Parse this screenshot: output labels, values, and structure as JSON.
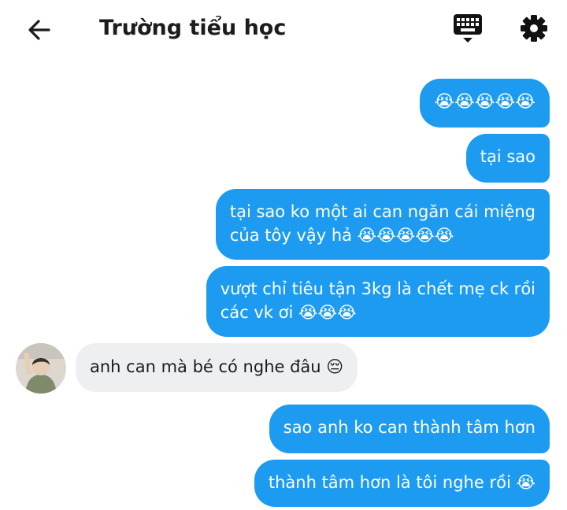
{
  "header": {
    "back_icon": "arrow-left-icon",
    "title": "Trường tiểu học",
    "keyboard_icon": "keyboard-icon",
    "settings_icon": "gear-icon"
  },
  "messages": [
    {
      "side": "out",
      "text": "😭😭😭😭😭"
    },
    {
      "side": "out",
      "text": "tại sao"
    },
    {
      "side": "out",
      "line1": "tại sao ko một ai can ngăn cái miệng",
      "line2": "của tôy vậy hả 😭😭😭😭😭"
    },
    {
      "side": "out",
      "line1": "vượt chỉ tiêu tận 3kg là chết mẹ ck rồi",
      "line2": "các vk ơi 😭😭😭"
    },
    {
      "side": "in",
      "text": "anh can mà bé có nghe đâu 😔"
    },
    {
      "side": "out",
      "text": "sao anh ko can thành tâm hơn"
    },
    {
      "side": "out",
      "text": "thành tâm hơn là tôi nghe rồi 😭"
    }
  ],
  "colors": {
    "outgoing_bubble": "#1d9bf0",
    "incoming_bubble": "#eeeff1",
    "header_text": "#1c1c1c"
  }
}
